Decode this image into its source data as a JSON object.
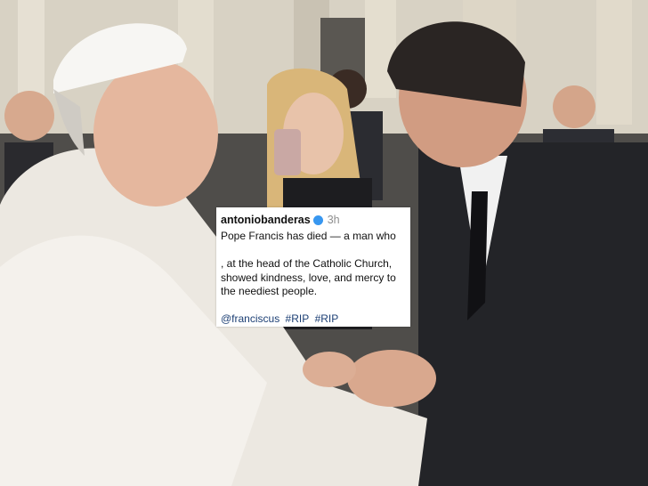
{
  "post": {
    "username": "antoniobanderas",
    "time": "3h",
    "lines": [
      "Pope Francis has died — a man who",
      ", at the head of the Catholic Church,",
      "showed kindness, love, and mercy to",
      "the neediest people."
    ],
    "tags": [
      "@franciscus",
      "#RIP",
      "#RIP"
    ]
  },
  "colors": {
    "link": "#1c3f74",
    "verified": "#3897f0",
    "muted": "#8e8e8e"
  },
  "icons": [
    "verified-check-icon"
  ]
}
